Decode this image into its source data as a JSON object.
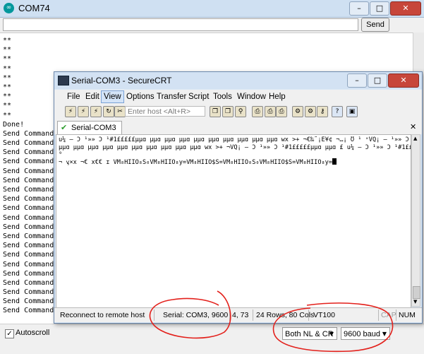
{
  "arduino": {
    "title": "COM74",
    "send_label": "Send",
    "input_value": "",
    "output_lines": [
      "**",
      "**",
      "**",
      "**",
      "**",
      "**",
      "**",
      "**",
      "**",
      "Done!",
      "Send Command",
      "Send Command",
      "Send Command",
      "Send Command",
      "Send Command",
      "Send Command",
      "Send Command",
      "Send Command",
      "Send Command",
      "Send Command",
      "Send Command",
      "Send Command",
      "Send Command",
      "Send Command",
      "Send Command",
      "Send Command",
      "Send Command",
      "Send Command",
      "Send Command",
      "Send Command"
    ],
    "autoscroll_label": "Autoscroll",
    "autoscroll_checked": true,
    "line_ending": "Both NL & CR",
    "baud": "9600 baud"
  },
  "securecrt": {
    "title": "Serial-COM3 - SecureCRT",
    "menu": [
      "File",
      "Edit",
      "View",
      "Options",
      "Transfer",
      "Script",
      "Tools",
      "Window",
      "Help"
    ],
    "active_menu": "View",
    "host_placeholder": "Enter host <Alt+R>",
    "tab_label": "Serial-COM3",
    "terminal_lines": [
      "u¼ – Ɔ ¹»» Ɔ ¹#1£££££µµɑ µµɑ µµɑ µµɑ µµɑ µµɑ µµɑ µµɑ µµɑ µµɑ wx >+ ¬€‰˜¡E¥¢ ¬…¡ Ʊ ¹ ˣVQ¡ – ¹»» Ɔ ¹#1£££££",
      "µµɑ µµɑ µµɑ µµɑ µµɑ µµɑ µµɑ µµɑ µµɑ µµɑ wx >+ ¬VQ¡ – Ɔ ¹»» Ɔ ¹#1£££££µµɑ µµɑ £ u¼ – Ɔ ¹»» Ɔ ¹#1£££££µ €",
      "⁹",
      "¬ ᶌ×x ¬€ x€€ ɪ VM₈HIIO₈S₀VM₈HIIO₈y=VM₈HIIO$S=VM₈HIIO₈S₀VM₈HIIO$S=VM₈HIIO₈y="
    ],
    "status": {
      "message": "Reconnect to remote host",
      "serial": "Serial: COM3, 9600",
      "cursor_pos": "4,  73",
      "dimensions": "24 Rows, 80 Cols",
      "emulation": "VT100",
      "caps": "CAP",
      "num": "NUM"
    }
  },
  "colors": {
    "annotation": "#e3201b",
    "arduino_teal": "#00979c",
    "titlebar": "#d3e2f3"
  }
}
